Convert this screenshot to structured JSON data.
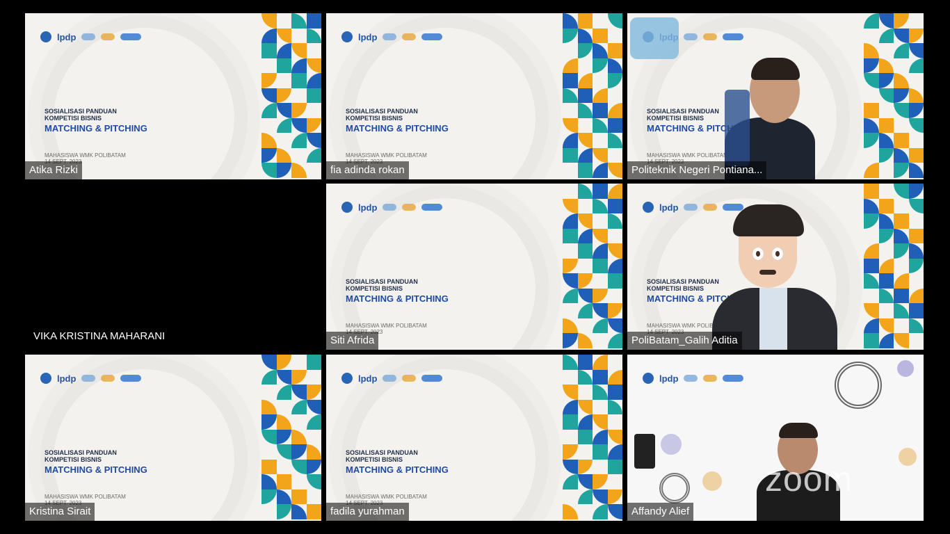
{
  "slide": {
    "logo_text": "lpdp",
    "title_line1": "SOSIALISASI PANDUAN",
    "title_line2": "KOMPETISI BISNIS",
    "title_line3": "MATCHING & PITCHING",
    "footer_line1": "MAHASISWA WMK POLIBATAM",
    "footer_line2": "14 SEPT. 2023"
  },
  "participants": [
    {
      "name": "Atika Rizki"
    },
    {
      "name": "fia adinda rokan"
    },
    {
      "name": "Politeknik Negeri Pontiana..."
    },
    {
      "name": "VIKA KRISTINA MAHARANI"
    },
    {
      "name": "Siti Afrida"
    },
    {
      "name": "PoliBatam_Galih Aditia"
    },
    {
      "name": "Kristina Sirait"
    },
    {
      "name": "fadila yurahman"
    },
    {
      "name": "Affandy Alief"
    }
  ],
  "watermark": "zoom"
}
